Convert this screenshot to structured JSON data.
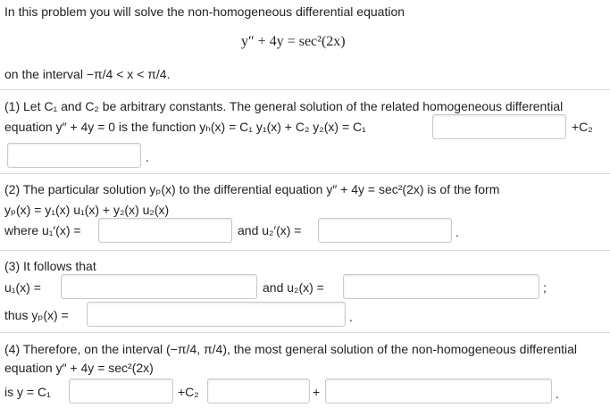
{
  "intro": {
    "text": "In this problem you will solve the non-homogeneous differential equation",
    "equation": "y″ + 4y = sec²(2x)",
    "interval_text": "on the interval −π/4 < x < π/4."
  },
  "part1": {
    "line1": "(1) Let C₁ and C₂ be arbitrary constants. The general solution of the related homogeneous differential",
    "line2": "equation y″ + 4y = 0 is the function yₕ(x) = C₁ y₁(x) + C₂ y₂(x) = C₁",
    "plus_c2": "+C₂",
    "period": "."
  },
  "part2": {
    "line1": "(2) The particular solution yₚ(x) to the differential equation y″ + 4y = sec²(2x) is of the form",
    "line2": "yₚ(x) = y₁(x) u₁(x) + y₂(x) u₂(x)",
    "where_label": "where u₁′(x) =",
    "and_label": "and u₂′(x) =",
    "period": "."
  },
  "part3": {
    "line1": "(3) It follows that",
    "u1_label": "u₁(x) =",
    "and_label": "and u₂(x) =",
    "semicolon": ";",
    "thus_label": "thus yₚ(x) =",
    "period": "."
  },
  "part4": {
    "line1": "(4) Therefore, on the interval (−π/4, π/4), the most general solution of the non-homogeneous differential",
    "line2": "equation y″ + 4y = sec²(2x)",
    "is_label": "is y = C₁",
    "plus_c2": "+C₂",
    "plus": "+",
    "period": "."
  }
}
